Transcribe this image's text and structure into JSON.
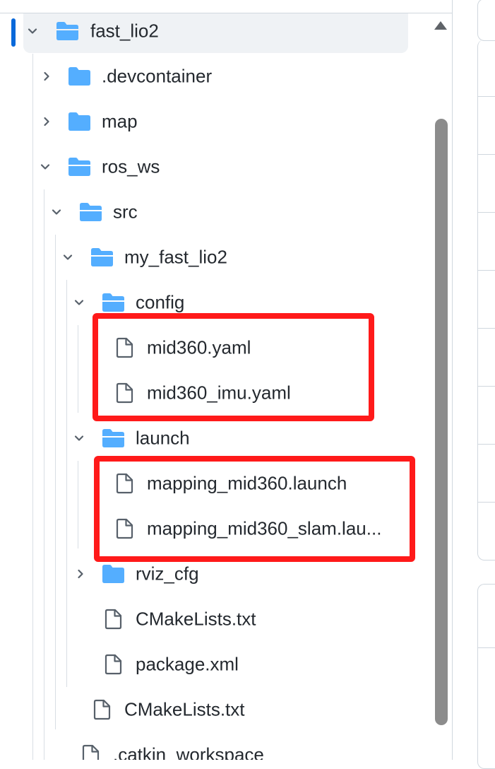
{
  "colors": {
    "folder": "#54aeff",
    "file_stroke": "#57606a",
    "highlight": "#ff1a1a",
    "active": "#0969da"
  },
  "tree": {
    "root": {
      "name": "fast_lio2",
      "icon": "folder-open-icon",
      "expanded": true
    },
    "devcontainer": {
      "name": ".devcontainer",
      "icon": "folder-icon"
    },
    "map": {
      "name": "map",
      "icon": "folder-icon"
    },
    "ros_ws": {
      "name": "ros_ws",
      "icon": "folder-open-icon"
    },
    "src": {
      "name": "src",
      "icon": "folder-open-icon"
    },
    "my_fast_lio2": {
      "name": "my_fast_lio2",
      "icon": "folder-open-icon"
    },
    "config": {
      "name": "config",
      "icon": "folder-open-icon"
    },
    "mid360_yaml": {
      "name": "mid360.yaml",
      "icon": "file-icon"
    },
    "mid360_imu_yaml": {
      "name": "mid360_imu.yaml",
      "icon": "file-icon"
    },
    "launch": {
      "name": "launch",
      "icon": "folder-open-icon"
    },
    "mapping_launch": {
      "name": "mapping_mid360.launch",
      "icon": "file-icon"
    },
    "mapping_slam_launch": {
      "name": "mapping_mid360_slam.lau...",
      "icon": "file-icon"
    },
    "rviz_cfg": {
      "name": "rviz_cfg",
      "icon": "folder-icon"
    },
    "cmakelists_pkg": {
      "name": "CMakeLists.txt",
      "icon": "file-icon"
    },
    "package_xml": {
      "name": "package.xml",
      "icon": "file-icon"
    },
    "cmakelists_src": {
      "name": "CMakeLists.txt",
      "icon": "file-icon"
    },
    "catkin_workspace": {
      "name": ".catkin_workspace",
      "icon": "file-icon"
    }
  }
}
